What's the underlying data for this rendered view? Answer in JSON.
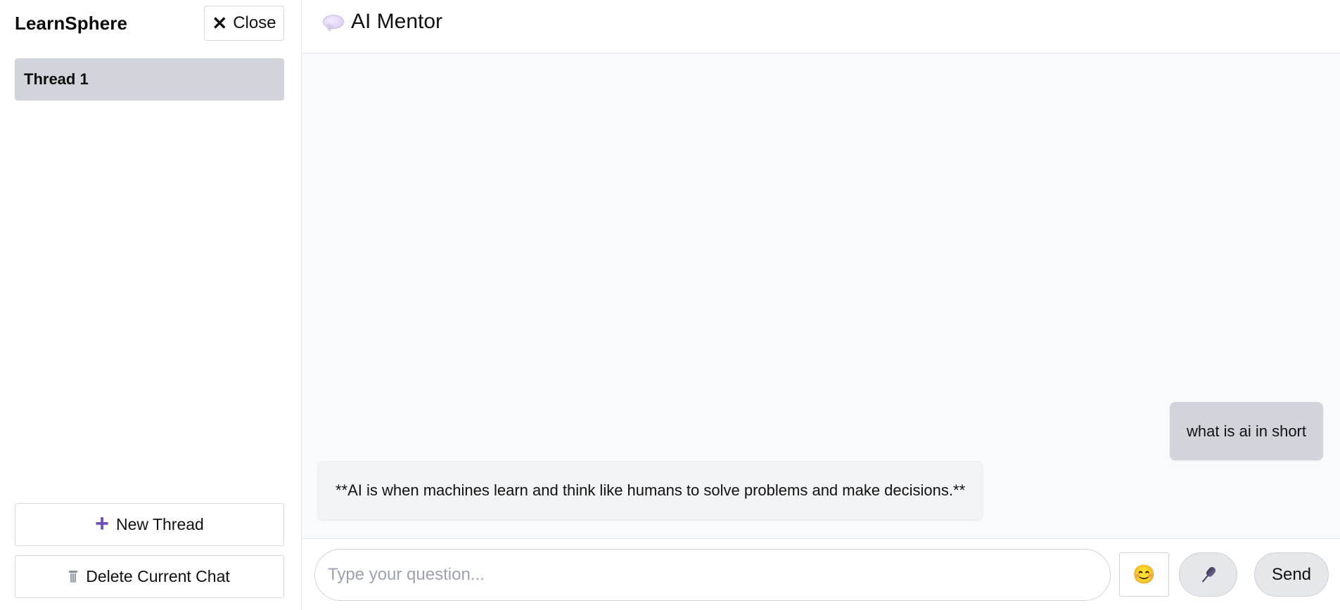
{
  "sidebar": {
    "brand": "LearnSphere",
    "close_label": "Close",
    "threads": [
      {
        "label": "Thread 1",
        "active": true
      }
    ],
    "new_thread_label": "New Thread",
    "delete_chat_label": "Delete Current Chat"
  },
  "header": {
    "title": "AI Mentor"
  },
  "messages": [
    {
      "role": "user",
      "text": "what is ai in short"
    },
    {
      "role": "assistant",
      "text": "**AI is when machines learn and think like humans to solve problems and make decisions.**"
    }
  ],
  "input": {
    "placeholder": "Type your question...",
    "value": "",
    "emoji": "😊",
    "send_label": "Send"
  },
  "icons": {
    "close": "close-icon",
    "plus": "plus-icon",
    "trash": "trash-icon",
    "chat_bubble": "chat-bubble-icon",
    "emoji": "emoji-icon",
    "microphone": "microphone-icon"
  },
  "colors": {
    "accent_purple": "#6d4ec2",
    "active_thread_bg": "#d1d5db",
    "chat_bg": "#f9fafb",
    "user_bubble": "#d1d5db",
    "bot_bubble": "#f3f4f6"
  }
}
